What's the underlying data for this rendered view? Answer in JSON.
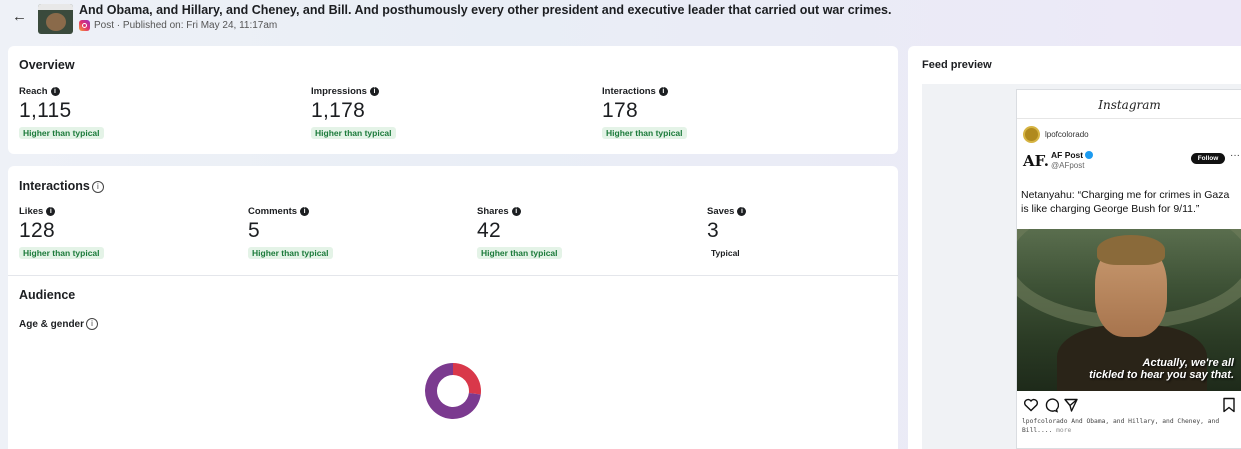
{
  "header": {
    "back_icon": "arrow-left-icon",
    "title": "And Obama, and Hillary, and Cheney, and Bill. And posthumously every other president and executive leader that carried out war crimes.",
    "meta": "Post · Published on: Fri May 24, 11:17am"
  },
  "overview": {
    "title": "Overview",
    "metrics": [
      {
        "label": "Reach",
        "value": "1,115",
        "badge": "Higher than typical"
      },
      {
        "label": "Impressions",
        "value": "1,178",
        "badge": "Higher than typical"
      },
      {
        "label": "Interactions",
        "value": "178",
        "badge": "Higher than typical"
      }
    ]
  },
  "interactions": {
    "title": "Interactions",
    "metrics": [
      {
        "label": "Likes",
        "value": "128",
        "badge": "Higher than typical"
      },
      {
        "label": "Comments",
        "value": "5",
        "badge": "Higher than typical"
      },
      {
        "label": "Shares",
        "value": "42",
        "badge": "Higher than typical"
      },
      {
        "label": "Saves",
        "value": "3",
        "badge": "Typical"
      }
    ]
  },
  "audience": {
    "title": "Audience",
    "subtitle": "Age & gender",
    "donut": {
      "segments": [
        {
          "share": 0.27,
          "color": "#d9384a"
        },
        {
          "share": 0.73,
          "color": "#7b3a8f"
        }
      ]
    }
  },
  "feed_preview": {
    "title": "Feed preview",
    "platform": "Instagram",
    "account": "lpofcolorado",
    "tweet_logo": "AF.",
    "tweet_name": "AF Post",
    "tweet_handle": "@AFpost",
    "follow_label": "Follow",
    "more_icon": "···",
    "tweet_text": "Netanyahu: “Charging me for crimes in Gaza is like charging George Bush for 9/11.”",
    "meme_caption_1": "Actually, we're all",
    "meme_caption_2": "tickled to hear you say that.",
    "caption": "lpofcolorado And Obama, and Hillary, and Cheney, and Bill....",
    "caption_more": "more"
  },
  "colors": {
    "badge_green": "#1b7a3a",
    "badge_bg": "#e4f3e7"
  }
}
